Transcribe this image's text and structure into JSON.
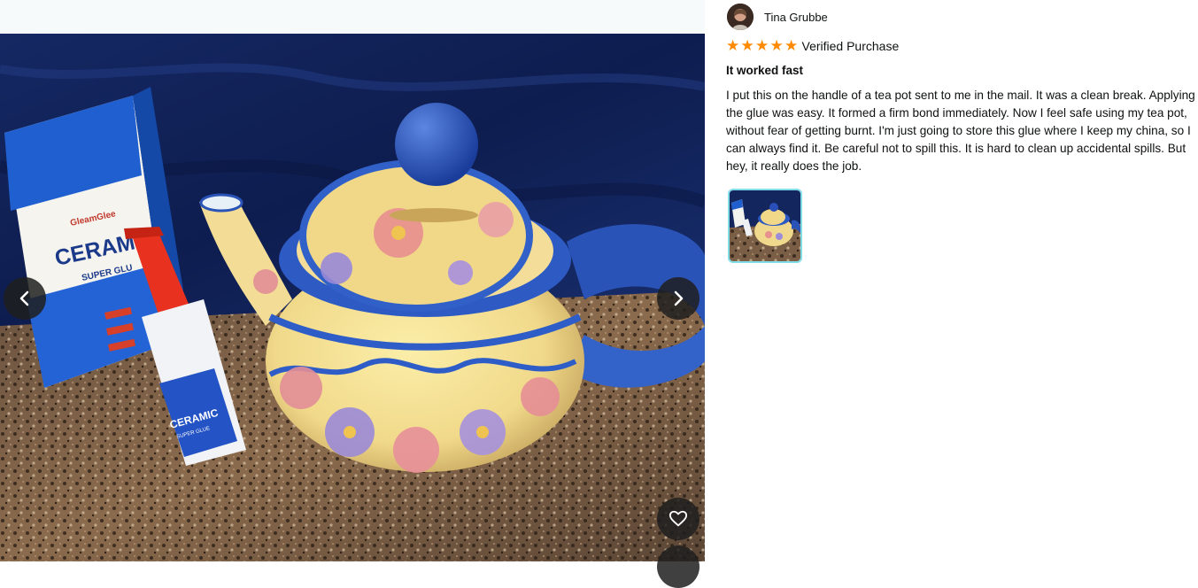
{
  "review": {
    "reviewer_name": "Tina Grubbe",
    "rating": 5,
    "rating_max": 5,
    "verified_label": "Verified Purchase",
    "title": "It worked fast",
    "body": "I put this on the handle of a tea pot sent to me in the mail. It was a clean break. Applying the glue was easy. It formed a firm bond immediately. Now I feel safe using my tea pot, without fear of getting burnt. I'm just going to store this glue where I keep my china, so I can always find it. Be careful not to spill this. It is hard to clean up accidental spills. But hey, it really does the job."
  },
  "photo": {
    "box_brand": "GleamGlee",
    "box_word": "CERAM",
    "box_sub": "SUPER GLU",
    "bottle_word": "CERAMIC",
    "bottle_sub": "SUPER GLUE"
  },
  "icons": {
    "prev": "chevron-left-icon",
    "next": "chevron-right-icon",
    "heart": "heart-icon",
    "star": "star-icon"
  },
  "colors": {
    "star": "#ff8a00",
    "thumb_border": "#7fdce8",
    "nav_bg": "#1e1e1e"
  }
}
